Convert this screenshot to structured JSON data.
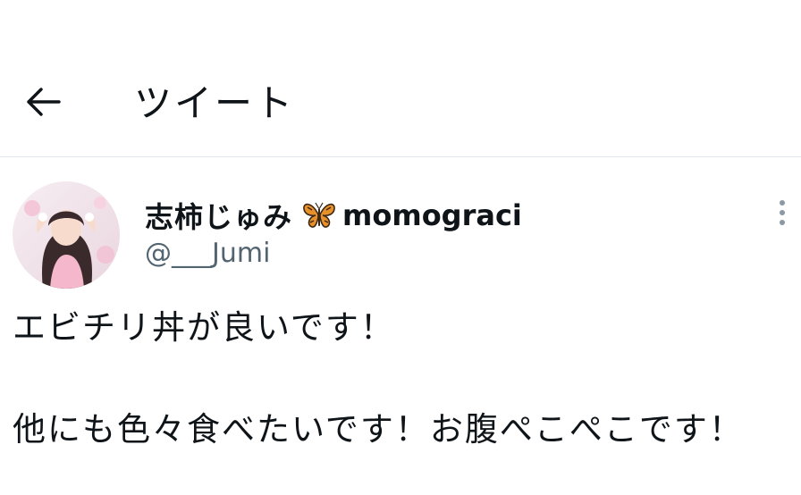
{
  "header": {
    "title": "ツイート"
  },
  "tweet": {
    "author_name": "志柿じゅみ",
    "author_name_suffix": "momograci",
    "author_handle": "@___Jumi",
    "text": "エビチリ丼が良いです！\n\n他にも色々食べたいです！お腹ぺこぺこです！"
  },
  "icons": {
    "back": "arrow-left-icon",
    "emoji": "butterfly-emoji-icon",
    "more": "more-vertical-icon"
  },
  "colors": {
    "text": "#0f1419",
    "secondary_text": "#536471",
    "divider": "#e1e4e8"
  }
}
